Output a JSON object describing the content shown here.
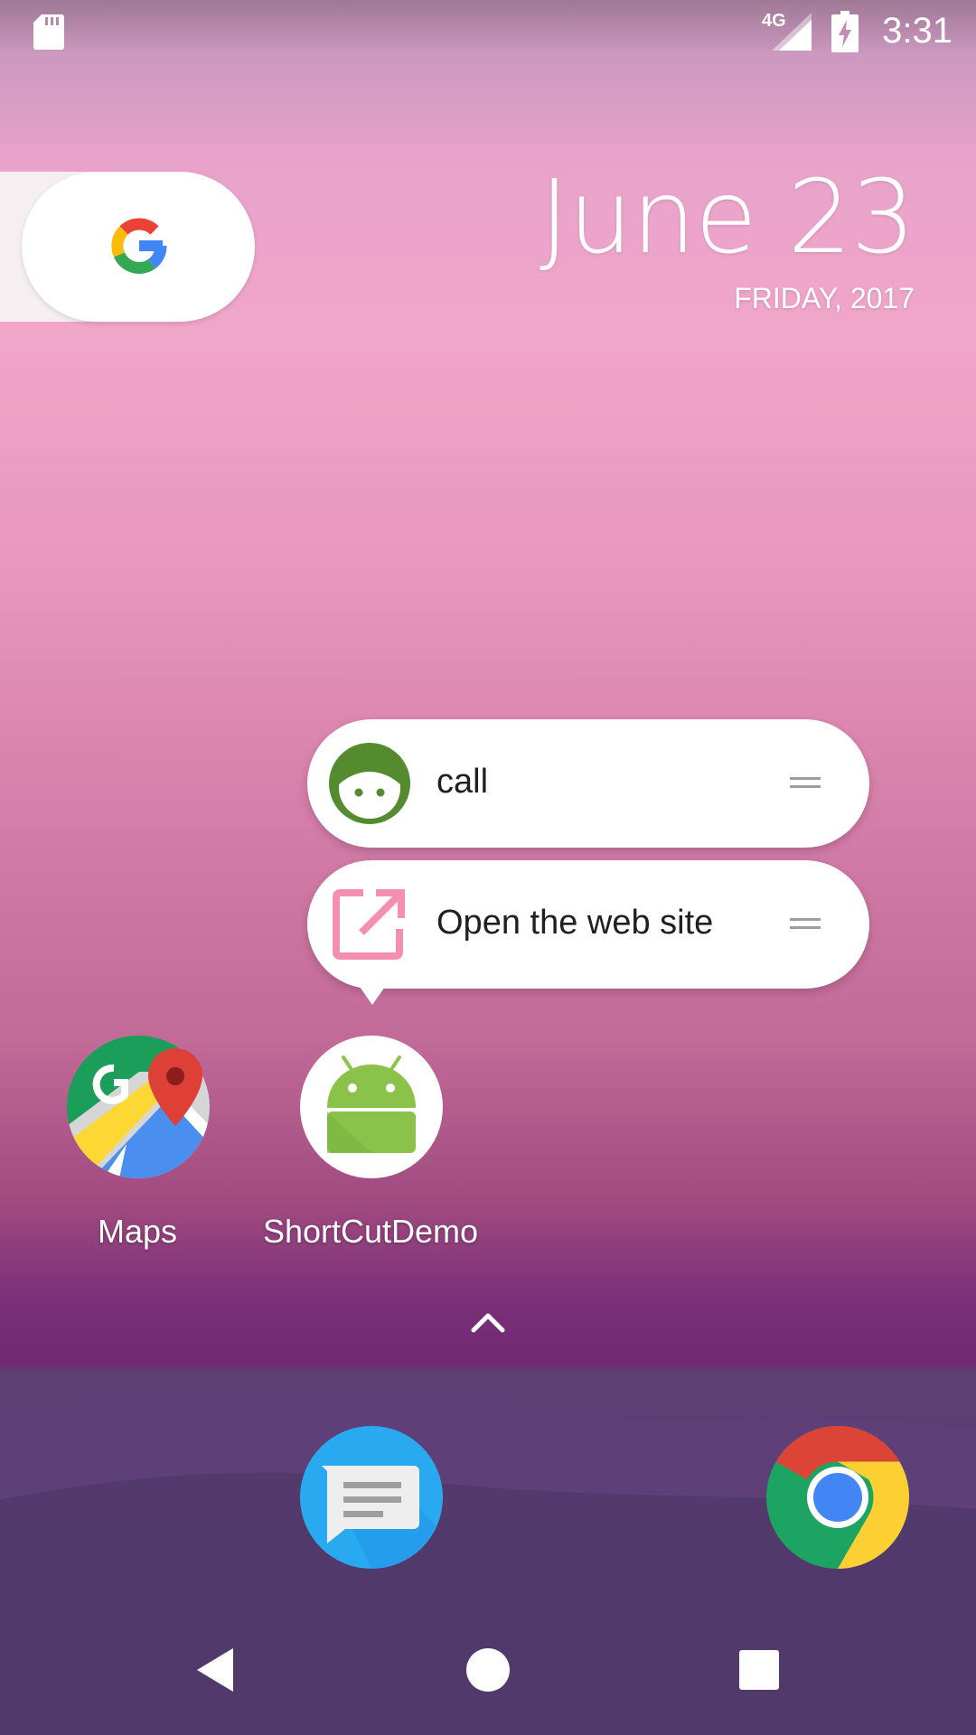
{
  "status_bar": {
    "network_label": "4G",
    "time": "3:31"
  },
  "date_widget": {
    "date": "June 23",
    "weekday_year": "FRIDAY, 2017"
  },
  "shortcuts": [
    {
      "label": "call",
      "icon": "face-icon"
    },
    {
      "label": "Open the web site",
      "icon": "open-external-icon"
    }
  ],
  "apps": [
    {
      "label": "Maps",
      "icon": "maps-icon"
    },
    {
      "label": "ShortCutDemo",
      "icon": "android-icon"
    }
  ],
  "dock": [
    {
      "icon": "messages-icon"
    },
    {
      "icon": "chrome-icon"
    }
  ],
  "colors": {
    "call_icon_green": "#558b2f",
    "web_icon_pink": "#f48fb1",
    "android_green": "#8bc34a",
    "messages_blue": "#29a9f0"
  }
}
